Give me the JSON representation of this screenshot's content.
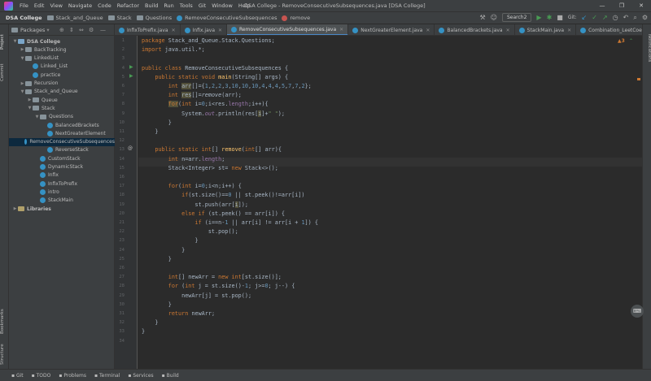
{
  "window": {
    "title": "DSA College - RemoveConsecutiveSubsequences.java [DSA College]"
  },
  "menu": [
    "File",
    "Edit",
    "View",
    "Navigate",
    "Code",
    "Refactor",
    "Build",
    "Run",
    "Tools",
    "Git",
    "Window",
    "Help"
  ],
  "breadcrumbs": [
    "DSA College",
    "Stack_and_Queue",
    "Stack",
    "Questions",
    "RemoveConsecutiveSubsequences",
    "remove"
  ],
  "toolbar": {
    "run_config": "Search2",
    "git_label": "Git:"
  },
  "project": {
    "header": "Packages",
    "items": [
      {
        "label": "DSA College",
        "depth": 0,
        "kind": "module",
        "expanded": true
      },
      {
        "label": "BackTracking",
        "depth": 1,
        "kind": "folder",
        "expanded": false
      },
      {
        "label": "LinkedList",
        "depth": 1,
        "kind": "folder",
        "expanded": true
      },
      {
        "label": "Linked_List",
        "depth": 2,
        "kind": "class"
      },
      {
        "label": "practice",
        "depth": 2,
        "kind": "class"
      },
      {
        "label": "Recursion",
        "depth": 1,
        "kind": "folder",
        "expanded": false
      },
      {
        "label": "Stack_and_Queue",
        "depth": 1,
        "kind": "folder",
        "expanded": true
      },
      {
        "label": "Queue",
        "depth": 2,
        "kind": "folder",
        "expanded": false
      },
      {
        "label": "Stack",
        "depth": 2,
        "kind": "folder",
        "expanded": true
      },
      {
        "label": "Questions",
        "depth": 3,
        "kind": "folder",
        "expanded": true
      },
      {
        "label": "BalancedBrackets",
        "depth": 4,
        "kind": "class"
      },
      {
        "label": "NextGreaterElement",
        "depth": 4,
        "kind": "class"
      },
      {
        "label": "RemoveConsecutiveSubsequences",
        "depth": 4,
        "kind": "class",
        "selected": true
      },
      {
        "label": "ReverseStack",
        "depth": 4,
        "kind": "class"
      },
      {
        "label": "CustomStack",
        "depth": 3,
        "kind": "class"
      },
      {
        "label": "DynamicStack",
        "depth": 3,
        "kind": "class"
      },
      {
        "label": "Infix",
        "depth": 3,
        "kind": "class"
      },
      {
        "label": "InfixToPrefix",
        "depth": 3,
        "kind": "class"
      },
      {
        "label": "intro",
        "depth": 3,
        "kind": "class"
      },
      {
        "label": "StackMain",
        "depth": 3,
        "kind": "class"
      },
      {
        "label": "Libraries",
        "depth": 0,
        "kind": "lib",
        "expanded": false
      }
    ]
  },
  "left_tools": [
    "Project",
    "Commit",
    "Bookmarks",
    "Structure"
  ],
  "right_tools": [
    "Notifications"
  ],
  "tabs": [
    {
      "label": "InfixToPrefix.java"
    },
    {
      "label": "Infix.java"
    },
    {
      "label": "RemoveConsecutiveSubsequences.java",
      "active": true
    },
    {
      "label": "NextGreaterElement.java"
    },
    {
      "label": "BalancedBrackets.java"
    },
    {
      "label": "StackMain.java"
    },
    {
      "label": "Combination_LeetCoe.java"
    }
  ],
  "inspection": {
    "warnings": "▲3"
  },
  "statusbar": [
    "Git",
    "TODO",
    "Problems",
    "Terminal",
    "Services",
    "Build"
  ],
  "colors": {
    "keyword": "#cc7832",
    "number": "#6897bb",
    "string": "#6a8759",
    "method": "#ffc66d",
    "field": "#9876aa",
    "accent": "#4a88c7"
  }
}
